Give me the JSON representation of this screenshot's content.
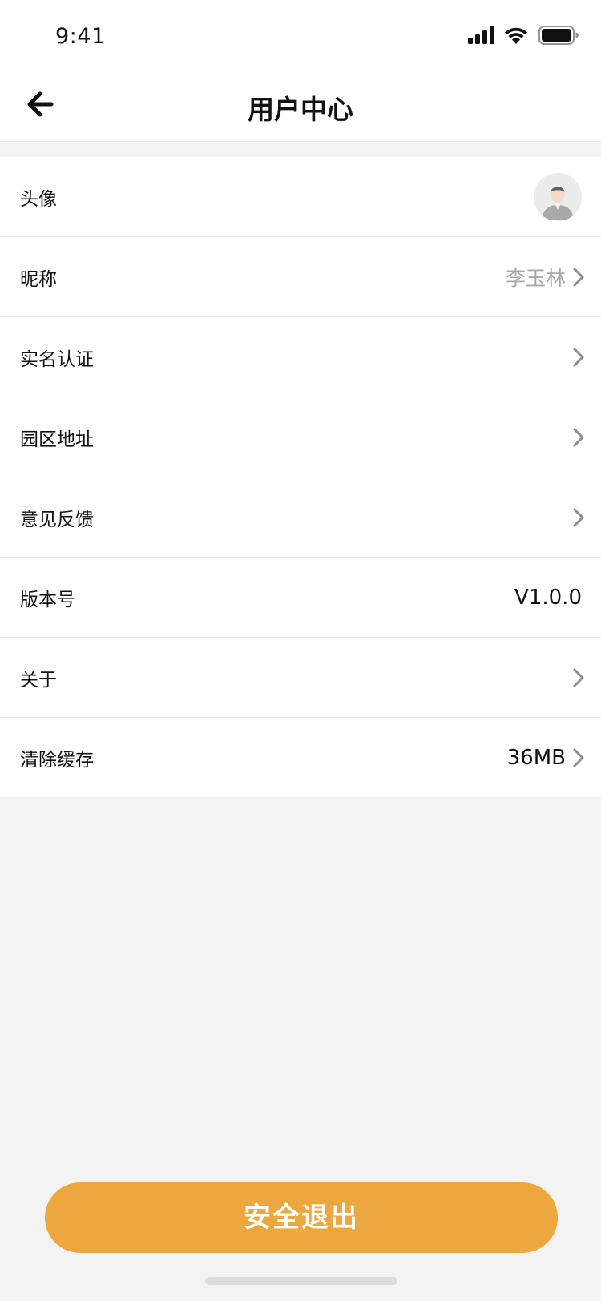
{
  "status_bar": {
    "time": "9:41",
    "icons": [
      "signal-icon",
      "wifi-icon",
      "battery-icon"
    ]
  },
  "header": {
    "title": "用户中心",
    "back_icon": "back-arrow-icon"
  },
  "settings": {
    "avatar_label": "头像",
    "nickname_label": "昵称",
    "nickname_value": "李玉林",
    "realname_label": "实名认证",
    "address_label": "园区地址",
    "feedback_label": "意见反馈",
    "version_label": "版本号",
    "version_value": "V1.0.0",
    "about_label": "关于",
    "cache_label": "清除缓存",
    "cache_value": "36MB"
  },
  "logout_label": "安全退出",
  "colors": {
    "accent": "#eca83e",
    "background": "#f3f3f3",
    "muted_text": "#a8a8a8",
    "chevron": "#8d8d8d"
  }
}
